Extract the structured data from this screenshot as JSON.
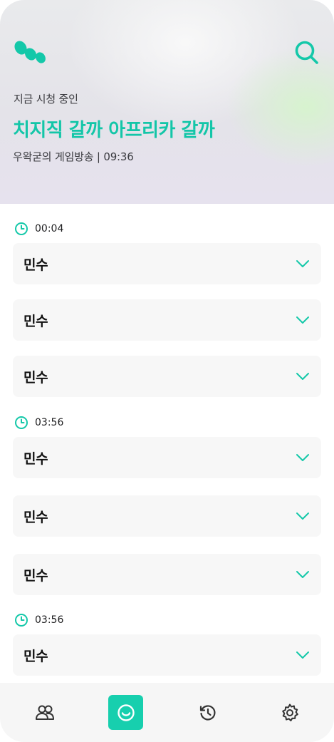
{
  "header": {
    "now_watching_label": "지금 시청 중인",
    "stream_title": "치지직 갈까 아프리카 갈까",
    "broadcast_meta": "우왁굳의 게임방송 | 09:36",
    "accent_color": "#13c6a8",
    "logo_icon": "brand-logo-icon",
    "search_icon": "search-icon"
  },
  "timeline": [
    {
      "time": "00:04",
      "items": [
        "민수",
        "민수",
        "민수"
      ]
    },
    {
      "time": "03:56",
      "items": [
        "민수",
        "민수",
        "민수"
      ]
    },
    {
      "time": "03:56",
      "items": [
        "민수"
      ]
    }
  ],
  "bottom_nav": {
    "items": [
      {
        "icon": "users-icon",
        "active": false
      },
      {
        "icon": "smile-icon",
        "active": true
      },
      {
        "icon": "history-icon",
        "active": false
      },
      {
        "icon": "settings-icon",
        "active": false
      }
    ],
    "active_color": "#17cfae"
  }
}
